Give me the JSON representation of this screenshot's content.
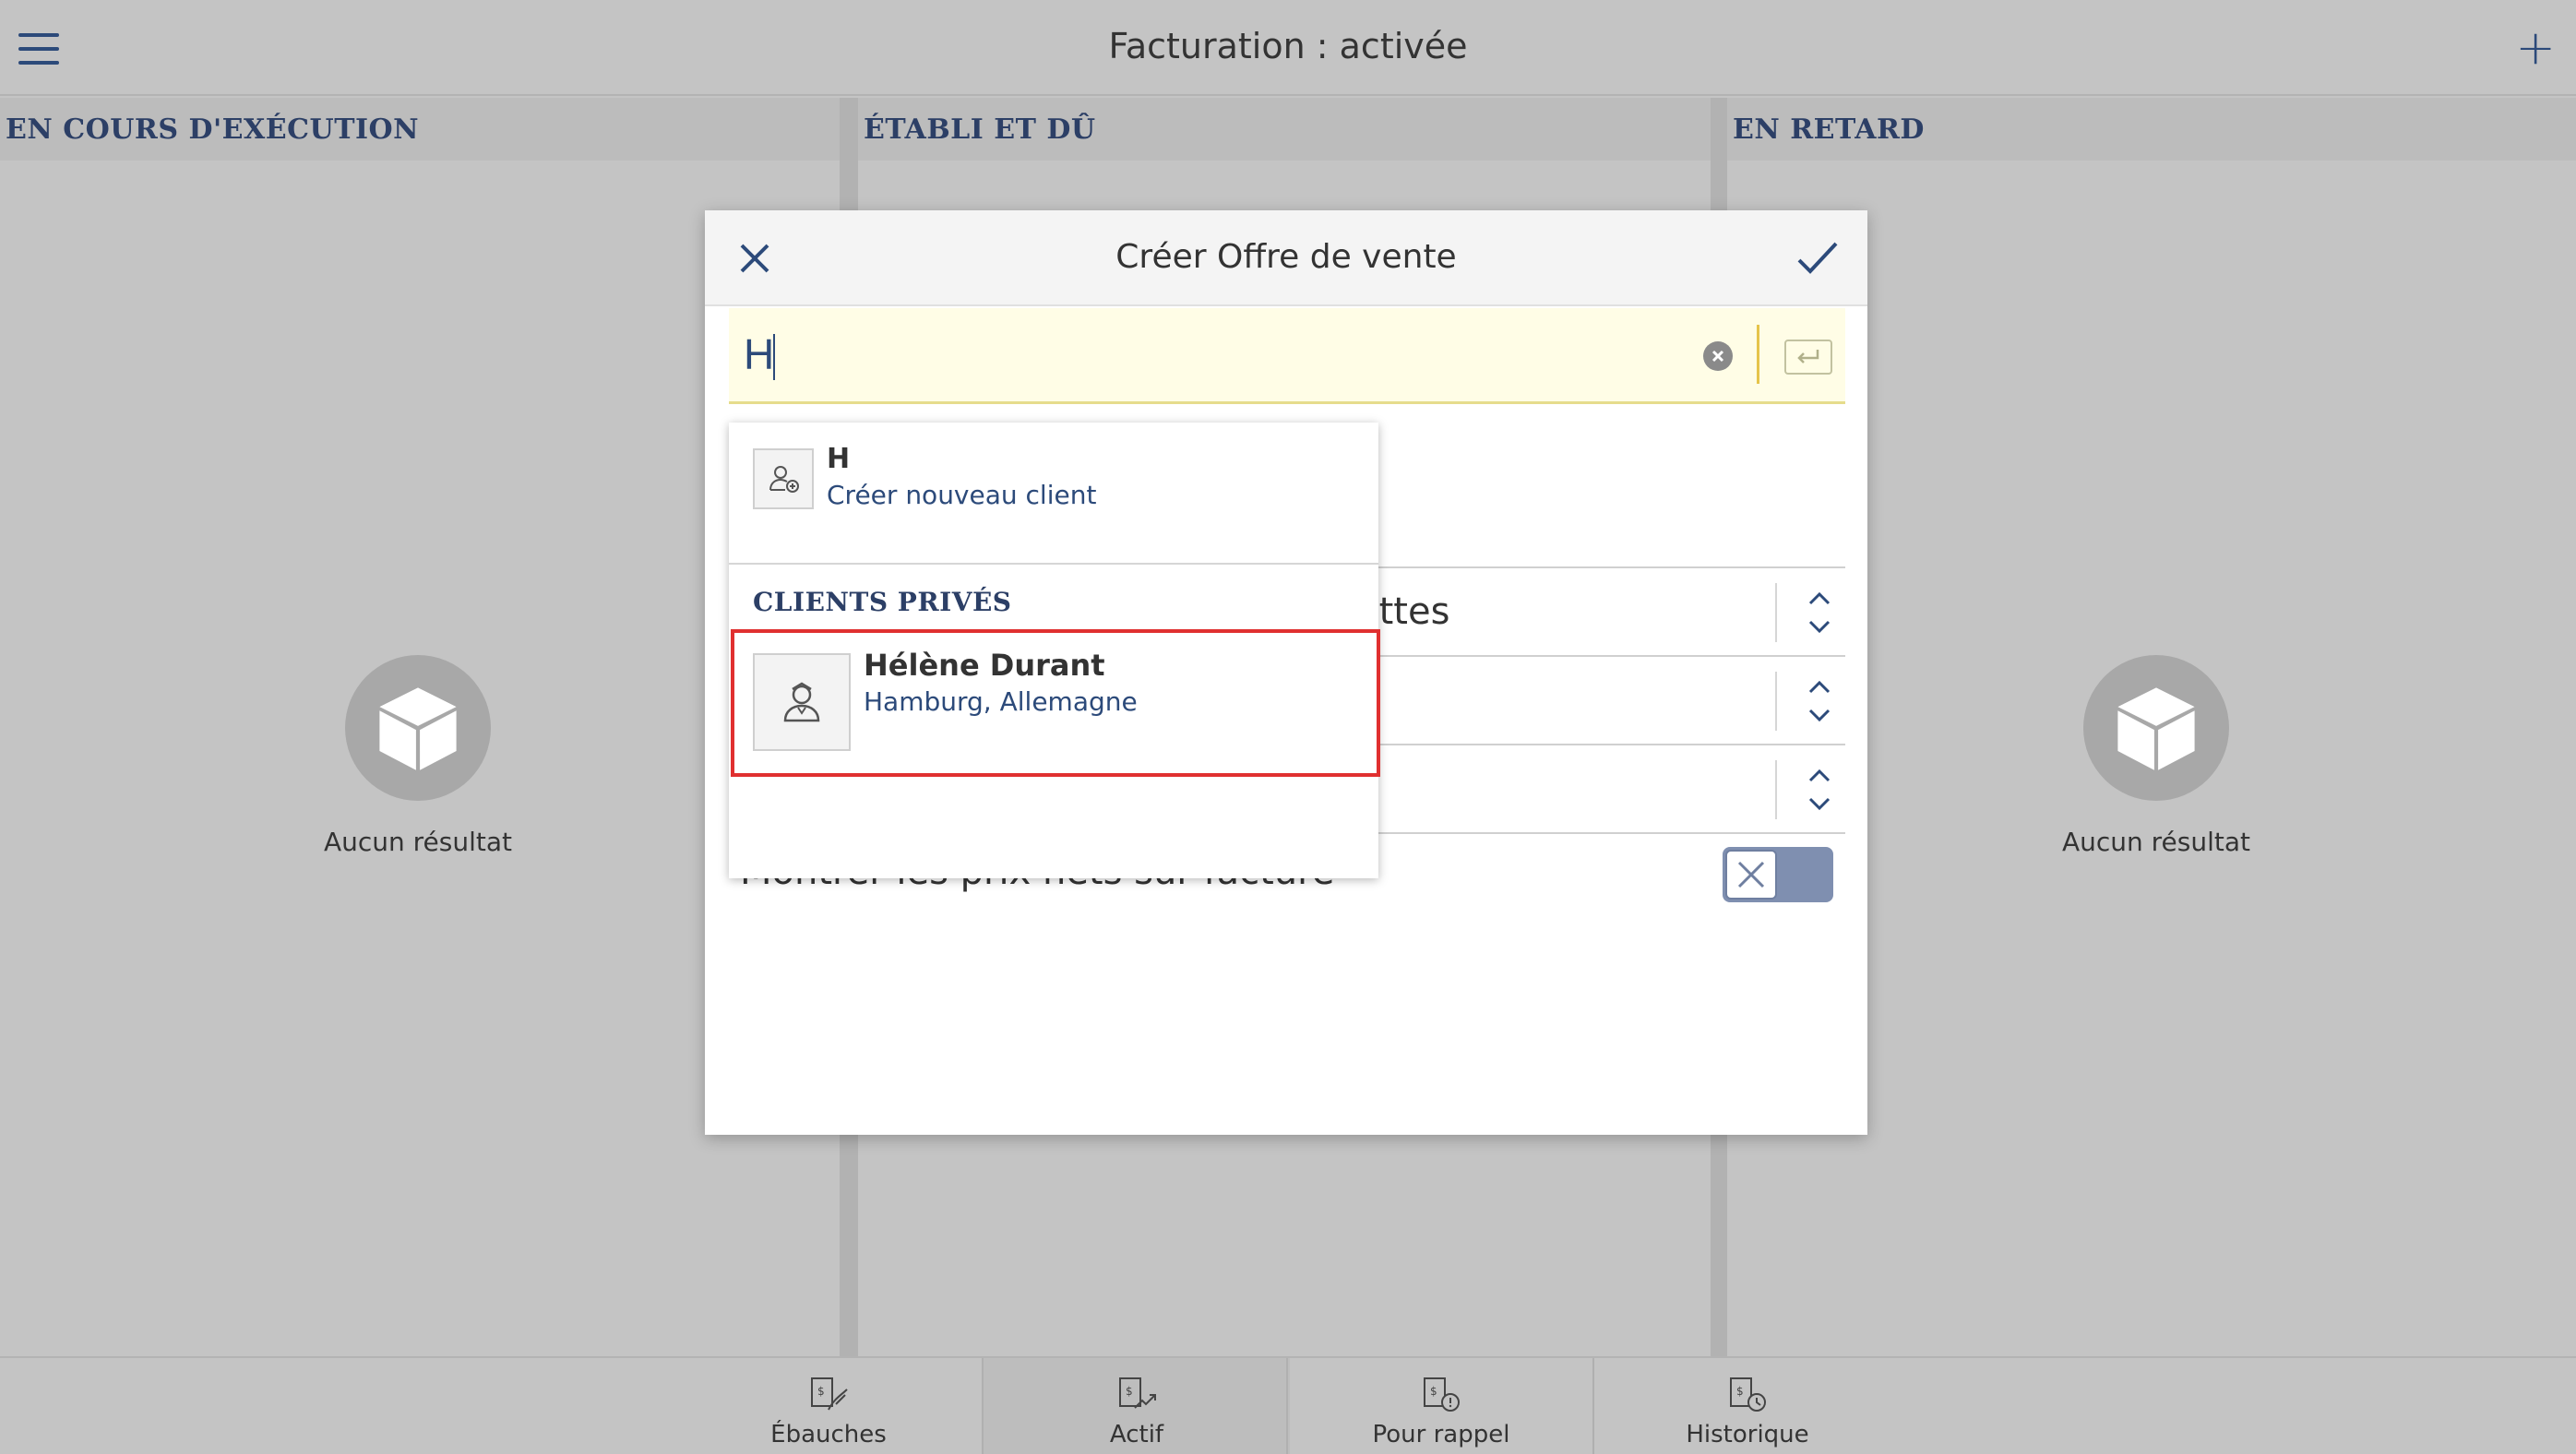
{
  "header": {
    "title": "Facturation : activée"
  },
  "columns": [
    {
      "title": "EN COURS D'EXÉCUTION",
      "empty_text": "Aucun résultat"
    },
    {
      "title": "ÉTABLI ET DÛ",
      "empty_text": ""
    },
    {
      "title": "EN RETARD",
      "empty_text": "Aucun résultat"
    }
  ],
  "tabs": [
    {
      "label": "Ébauches",
      "icon": "draft-invoice-icon",
      "active": false
    },
    {
      "label": "Actif",
      "icon": "active-invoice-icon",
      "active": true
    },
    {
      "label": "Pour rappel",
      "icon": "reminder-invoice-icon",
      "active": false
    },
    {
      "label": "Historique",
      "icon": "history-invoice-icon",
      "active": false
    }
  ],
  "modal": {
    "title": "Créer Offre de vente",
    "search_value": "H",
    "rows": [
      {
        "label_visible": "ettes"
      },
      {
        "label_visible": ""
      },
      {
        "label_visible": ""
      }
    ],
    "net_prices_label": "Montrer les prix nets sur facture"
  },
  "dropdown": {
    "create": {
      "title": "H",
      "subtitle": "Créer nouveau client"
    },
    "section_title": "CLIENTS PRIVÉS",
    "clients": [
      {
        "name": "Hélène Durant",
        "location": "Hamburg, Allemagne"
      }
    ]
  },
  "colors": {
    "background": "#c4c4c4",
    "accent_blue": "#2c4a7a",
    "search_bg": "#fffde6",
    "highlight_red": "#e03030",
    "toggle_bg": "#7f8fb0"
  }
}
